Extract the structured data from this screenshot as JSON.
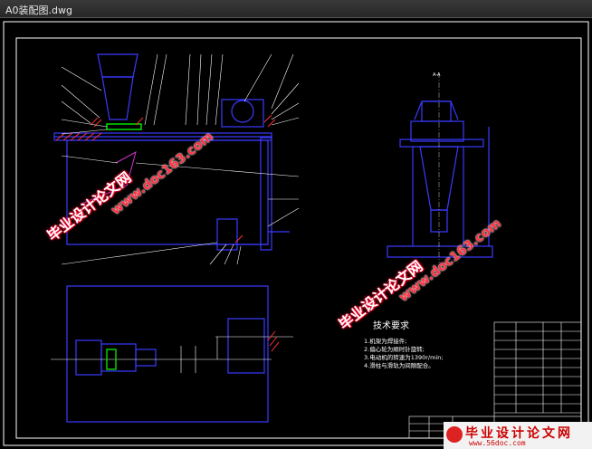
{
  "window": {
    "title": "A0装配图.dwg"
  },
  "drawing": {
    "section_label": "A-A",
    "tech_requirements": {
      "title": "技术要求",
      "lines": [
        "1.机架为焊接件;",
        "2.偏心轮为顺时针旋转;",
        "3.电动机的转速为1390r/min;",
        "4.滑柱与滑轨为间隙配合。"
      ]
    }
  },
  "watermarks": [
    {
      "text": "毕业设计论文网"
    },
    {
      "text": "www.doc163.com"
    }
  ],
  "footer": {
    "brand": "毕业设计论文网",
    "url": "www.56doc.com"
  },
  "colors": {
    "frame": "#ffffff",
    "outline": "#3a3aff",
    "part": "#00e000",
    "hatch": "#ff3030",
    "leader": "#ffffff"
  }
}
